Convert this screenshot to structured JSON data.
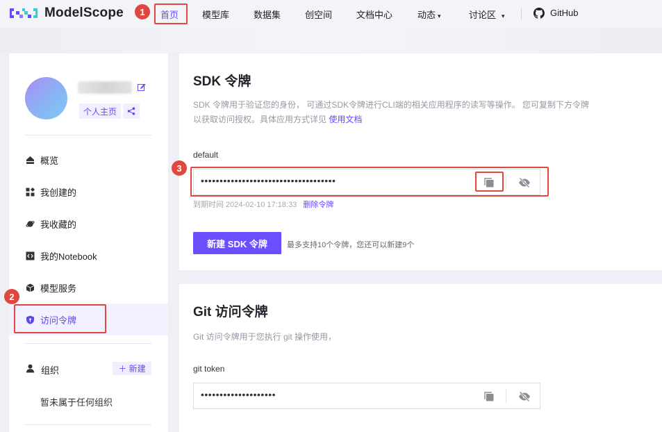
{
  "nav": {
    "logo_text": "ModelScope",
    "items": [
      {
        "label": "首页"
      },
      {
        "label": "模型库"
      },
      {
        "label": "数据集"
      },
      {
        "label": "创空间"
      },
      {
        "label": "文档中心"
      },
      {
        "label": "动态",
        "caret": "▾"
      },
      {
        "label": "讨论区",
        "caret": "▾"
      }
    ],
    "github": "GitHub"
  },
  "annotations": {
    "badge1": "1",
    "badge2": "2",
    "badge3": "3"
  },
  "sidebar": {
    "profile_button": "个人主页",
    "menu": [
      {
        "label": "概览",
        "icon": "home-icon"
      },
      {
        "label": "我创建的",
        "icon": "grid-icon"
      },
      {
        "label": "我收藏的",
        "icon": "planet-icon"
      },
      {
        "label": "我的Notebook",
        "icon": "code-icon"
      },
      {
        "label": "模型服务",
        "icon": "cube-icon"
      },
      {
        "label": "访问令牌",
        "icon": "shield-icon",
        "active": true
      }
    ],
    "org_label": "组织",
    "new_button": "＋ 新建",
    "no_org_text": "暂未属于任何组织"
  },
  "sdk": {
    "title": "SDK 令牌",
    "desc_line1": "SDK 令牌用于验证您的身份， 可通过SDK令牌进行CLI端的相关应用程序的读写等操作。 您可复制下方令牌",
    "desc_line2": "以获取访问授权。具体应用方式详见 ",
    "desc_link": "使用文档",
    "token_name": "default",
    "token_masked": "••••••••••••••••••••••••••••••••••••",
    "expiry": "到期时间 2024-02-10 17:18:33",
    "delete_link": "删除令牌",
    "create_button": "新建 SDK 令牌",
    "hint": "最多支持10个令牌，您还可以新建9个"
  },
  "git": {
    "title": "Git 访问令牌",
    "desc": "Git 访问令牌用于您执行 git 操作使用，",
    "token_name": "git token",
    "token_masked": "••••••••••••••••••••"
  },
  "colors": {
    "accent": "#624aff",
    "highlight": "#e0473e",
    "button": "#6c4dff"
  }
}
